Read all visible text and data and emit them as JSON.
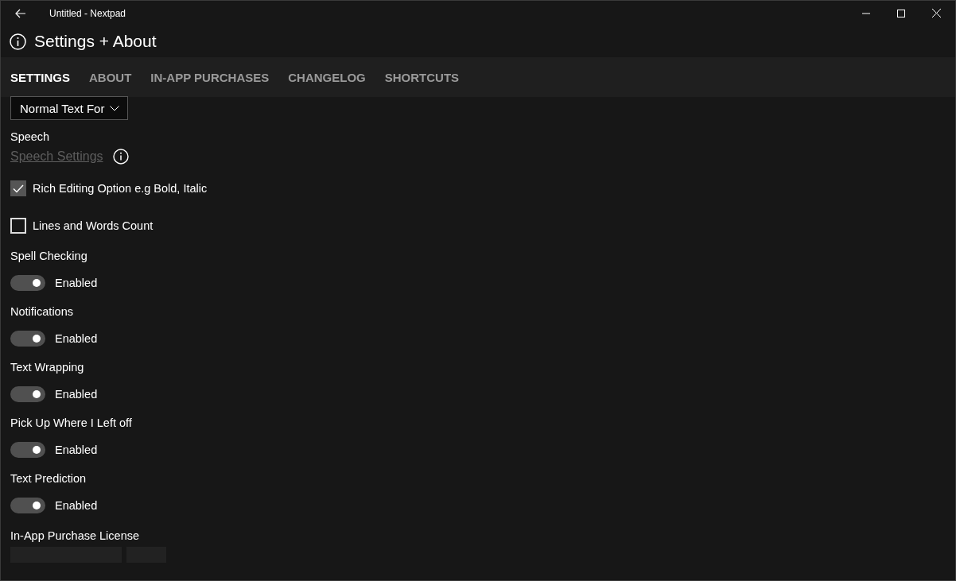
{
  "window": {
    "title": "Untitled - Nextpad"
  },
  "header": {
    "title": "Settings + About"
  },
  "tabs": [
    {
      "label": "SETTINGS",
      "selected": true
    },
    {
      "label": "ABOUT",
      "selected": false
    },
    {
      "label": "IN-APP PURCHASES",
      "selected": false
    },
    {
      "label": "CHANGELOG",
      "selected": false
    },
    {
      "label": "SHORTCUTS",
      "selected": false
    }
  ],
  "font_dropdown": {
    "value": "Normal Text For"
  },
  "speech": {
    "label": "Speech",
    "link": "Speech Settings"
  },
  "checkboxes": [
    {
      "label": "Rich Editing Option e.g Bold, Italic",
      "checked": true
    },
    {
      "label": "Lines and Words Count",
      "checked": false
    }
  ],
  "toggles": [
    {
      "label": "Spell Checking",
      "state": "Enabled",
      "on": true
    },
    {
      "label": "Notifications",
      "state": "Enabled",
      "on": true
    },
    {
      "label": "Text Wrapping",
      "state": "Enabled",
      "on": true
    },
    {
      "label": "Pick Up Where I Left off",
      "state": "Enabled",
      "on": true
    },
    {
      "label": "Text Prediction",
      "state": "Enabled",
      "on": true
    }
  ],
  "license": {
    "label": "In-App Purchase License"
  }
}
